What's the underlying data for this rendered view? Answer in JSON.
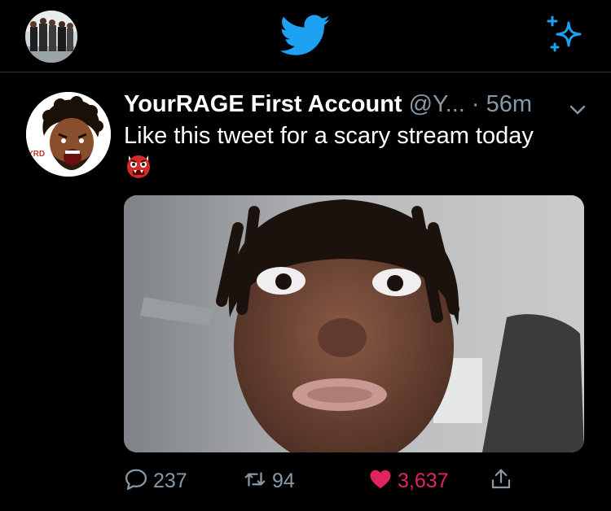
{
  "app": {
    "brand_color": "#1da1f2",
    "like_color": "#e0245e",
    "muted_color": "#8899a6"
  },
  "topbar": {
    "profile_avatar": "profile-avatar",
    "center_icon": "twitter-bird-icon",
    "right_icon": "sparkle-icon"
  },
  "tweet": {
    "author_name": "YourRAGE First Account",
    "handle": "@Y...",
    "separator": "·",
    "time": "56m",
    "text": "Like this tweet for a scary stream today",
    "emoji_icon": "ogre-emoji-icon",
    "avatar_badge": "YRD"
  },
  "actions": {
    "reply_count": "237",
    "retweet_count": "94",
    "like_count": "3,637",
    "liked": true
  }
}
